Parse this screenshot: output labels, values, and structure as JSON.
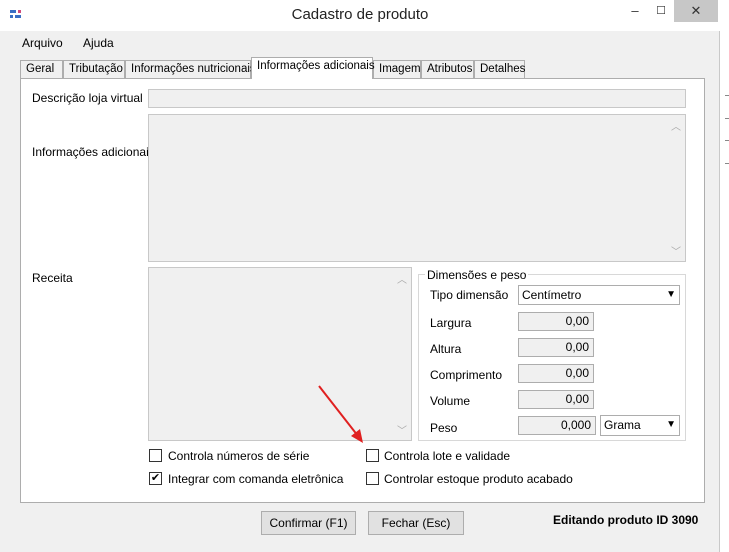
{
  "window": {
    "title": "Cadastro de produto",
    "minimize": "–",
    "maximize": "☐",
    "close": "✕"
  },
  "menu": [
    "Arquivo",
    "Ajuda"
  ],
  "tabs": [
    "Geral",
    "Tributação",
    "Informações nutricionais",
    "Informações adicionais",
    "Imagem",
    "Atributos",
    "Detalhes"
  ],
  "active_tab": "Informações adicionais",
  "form": {
    "descricao_label": "Descrição loja virtual",
    "descricao_value": "",
    "info_label": "Informações adicionais",
    "info_value": "",
    "receita_label": "Receita",
    "receita_value": ""
  },
  "dimensoes": {
    "title": "Dimensões e peso",
    "tipo_label": "Tipo dimensão",
    "tipo_value": "Centímetro",
    "largura_label": "Largura",
    "largura_value": "0,00",
    "altura_label": "Altura",
    "altura_value": "0,00",
    "comprimento_label": "Comprimento",
    "comprimento_value": "0,00",
    "volume_label": "Volume",
    "volume_value": "0,00",
    "peso_label": "Peso",
    "peso_value": "0,000",
    "peso_unit": "Grama"
  },
  "checkboxes": {
    "serie": {
      "label": "Controla números de série",
      "checked": false
    },
    "lote": {
      "label": "Controla lote e validade",
      "checked": false
    },
    "comanda": {
      "label": "Integrar com comanda eletrônica",
      "checked": true
    },
    "estoque": {
      "label": "Controlar estoque produto acabado",
      "checked": false
    }
  },
  "buttons": {
    "confirmar": "Confirmar (F1)",
    "fechar": "Fechar (Esc)"
  },
  "status": "Editando produto ID 3090",
  "colors": {
    "annotation_arrow": "#e02020",
    "close_button": "#c7c7c7"
  }
}
